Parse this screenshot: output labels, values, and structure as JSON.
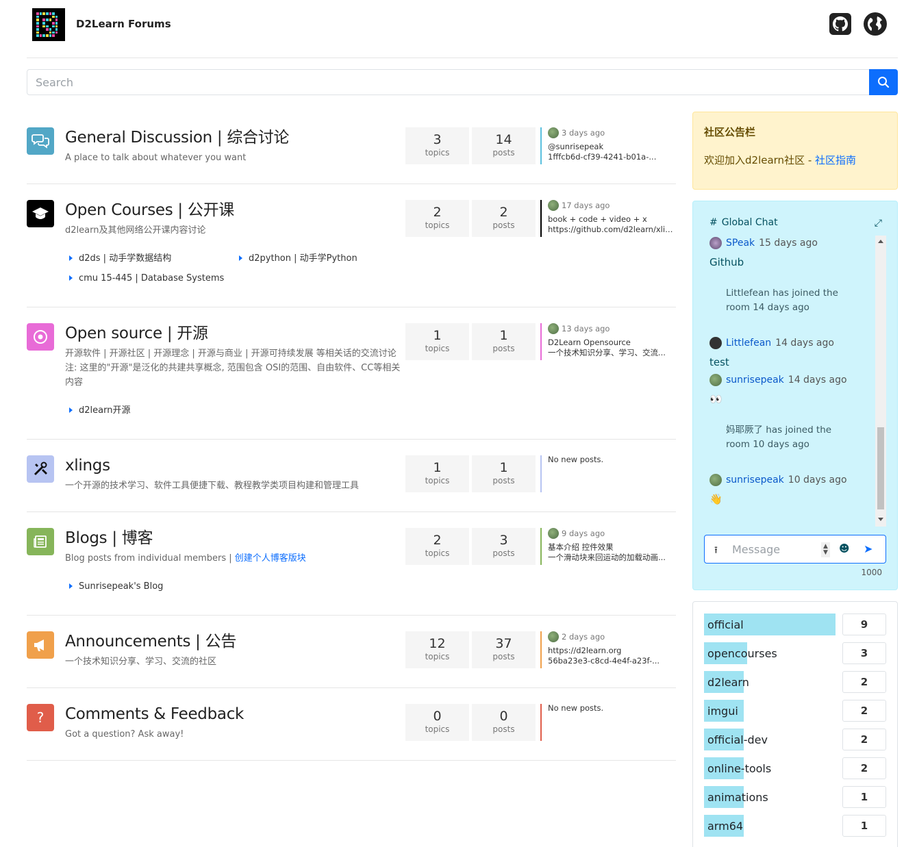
{
  "header": {
    "brand": "D2Learn Forums",
    "github_icon": "github-icon",
    "globe_icon": "globe-icon"
  },
  "search": {
    "placeholder": "Search",
    "button_icon": "search-icon"
  },
  "categories": [
    {
      "title": "General Discussion | 综合讨论",
      "desc": "A place to talk about whatever you want",
      "icon": "chat-bubbles-icon",
      "color": "#52a7c6",
      "topics": "3",
      "topics_label": "topics",
      "posts": "14",
      "posts_label": "posts",
      "last_ago": "3 days ago",
      "last_line1": "@sunrisepeak",
      "last_line2": "1fffcb6d-cf39-4241-b01a-...",
      "border": "#5bc0de"
    },
    {
      "title": "Open Courses | 公开课",
      "desc": "d2learn及其他网络公开课内容讨论",
      "icon": "graduation-cap-icon",
      "color": "#000000",
      "topics": "2",
      "topics_label": "topics",
      "posts": "2",
      "posts_label": "posts",
      "last_ago": "17 days ago",
      "last_line1": "book + code + video + x",
      "last_line2": "https://github.com/d2learn/xlin...",
      "border": "#000000",
      "subs": [
        "d2ds | 动手学数据结构",
        "d2python | 动手学Python",
        "cmu 15-445 | Database Systems"
      ]
    },
    {
      "title": "Open source | 开源",
      "desc": "开源软件 | 开源社区 | 开源理念 | 开源与商业 | 开源可持续发展 等相关话的交流讨论",
      "desc2": "注: 这里的\"开源\"是泛化的共建共享概念, 范围包含 OSI的范围、自由软件、CC等相关内容",
      "icon": "open-source-icon",
      "color": "#e86bd7",
      "topics": "1",
      "topics_label": "topics",
      "posts": "1",
      "posts_label": "posts",
      "last_ago": "13 days ago",
      "last_line1": "D2Learn Opensource",
      "last_line2": "一个技术知识分享、学习、交流...",
      "border": "#e86bd7",
      "subs": [
        "d2learn开源"
      ]
    },
    {
      "title": "xlings",
      "desc": "一个开源的技术学习、软件工具便捷下载、教程教学类项目构建和管理工具",
      "icon": "tools-icon",
      "color": "#b7c4f2",
      "topics": "1",
      "topics_label": "topics",
      "posts": "1",
      "posts_label": "posts",
      "no_new": "No new posts.",
      "border": "#b7c4f2"
    },
    {
      "title": "Blogs | 博客",
      "desc": "Blog posts from individual members | ",
      "desc_link": "创建个人博客版块",
      "icon": "newspaper-icon",
      "color": "#86b55a",
      "topics": "2",
      "topics_label": "topics",
      "posts": "3",
      "posts_label": "posts",
      "last_ago": "9 days ago",
      "last_line1": "基本介绍 控件效果",
      "last_line2": "一个滑动块来回运动的加载动画...",
      "border": "#86b55a",
      "subs": [
        "Sunrisepeak's Blog"
      ]
    },
    {
      "title": "Announcements | 公告",
      "desc": "一个技术知识分享、学习、交流的社区",
      "icon": "megaphone-icon",
      "color": "#f0a04b",
      "topics": "12",
      "topics_label": "topics",
      "posts": "37",
      "posts_label": "posts",
      "last_ago": "2 days ago",
      "last_line1": "https://d2learn.org",
      "last_line2": "56ba23e3-c8cd-4e4f-a23f-...",
      "border": "#f0a04b"
    },
    {
      "title": "Comments & Feedback",
      "desc": "Got a question? Ask away!",
      "icon": "question-icon",
      "color": "#e05d4a",
      "topics": "0",
      "topics_label": "topics",
      "posts": "0",
      "posts_label": "posts",
      "no_new": "No new posts.",
      "border": "#e05d4a"
    }
  ],
  "notice": {
    "title": "社区公告栏",
    "text": "欢迎加入d2learn社区 - ",
    "link": "社区指南"
  },
  "chat": {
    "title": "Global Chat",
    "messages": [
      {
        "user": "SPeak",
        "time": "15 days ago",
        "text": "Github"
      },
      {
        "system": "Littlefean has joined the room 14 days ago"
      },
      {
        "user": "Littlefean",
        "time": "14 days ago",
        "text": "test"
      },
      {
        "user": "sunrisepeak",
        "time": "14 days ago",
        "text": "👀"
      },
      {
        "system": "妈耶厥了 has joined the room 10 days ago"
      },
      {
        "user": "sunrisepeak",
        "time": "10 days ago",
        "text": "👋"
      }
    ],
    "input_placeholder": "Message",
    "char_limit": "1000"
  },
  "tags": [
    {
      "name": "official",
      "count": "9",
      "level": 1.0
    },
    {
      "name": "opencourses",
      "count": "3",
      "level": 0.33
    },
    {
      "name": "d2learn",
      "count": "2",
      "level": 0.22
    },
    {
      "name": "imgui",
      "count": "2",
      "level": 0.22
    },
    {
      "name": "official-dev",
      "count": "2",
      "level": 0.22
    },
    {
      "name": "online-tools",
      "count": "2",
      "level": 0.22
    },
    {
      "name": "animations",
      "count": "1",
      "level": 0.11
    },
    {
      "name": "arm64",
      "count": "1",
      "level": 0.11
    }
  ]
}
